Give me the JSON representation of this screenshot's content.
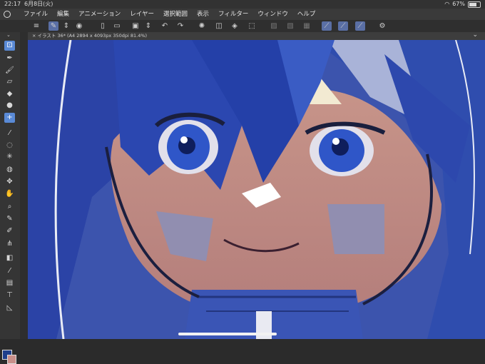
{
  "status_bar": {
    "time": "22:17",
    "date": "6月8日(火)",
    "battery": "67%"
  },
  "menu": {
    "items": [
      "ファイル",
      "編集",
      "アニメーション",
      "レイヤー",
      "選択範囲",
      "表示",
      "フィルター",
      "ウィンドウ",
      "ヘルプ"
    ]
  },
  "toolbar": {
    "icons": [
      "hamburger-menu-icon",
      "brush-tool-icon",
      "updown-icon",
      "record-icon",
      "new-file-icon",
      "open-folder-icon",
      "save-icon",
      "updown-icon",
      "undo-icon",
      "redo-icon",
      "selection-spinner-icon",
      "clear-icon",
      "fill-icon",
      "transform-icon",
      "mask-icon",
      "mask-icon",
      "mask-icon",
      "ruler-icon",
      "ruler-icon",
      "ruler-icon",
      "gear-icon"
    ]
  },
  "document": {
    "tab_title": "× イラスト 36* (A4 2894 x 4093px 350dpi 81.4%)"
  },
  "left_tools": [
    "select-icon",
    "pen-icon",
    "brush-icon",
    "eraser-icon",
    "fill-icon",
    "blend-icon",
    "add-icon",
    "eyedropper-icon",
    "lasso-icon",
    "magic-wand-icon",
    "lasso-fill-icon",
    "move-icon",
    "hand-icon",
    "zoom-icon",
    "pen-nib-icon",
    "pen-nib-icon",
    "grass-icon",
    "gradient-icon",
    "line-icon",
    "frame-icon",
    "text-icon",
    "balloon-icon"
  ],
  "colors": {
    "main": "#1f3f8c",
    "sub": "#c98f8a",
    "accent": "#5a6fa5",
    "canvas_bg": "#7b8fc6"
  }
}
